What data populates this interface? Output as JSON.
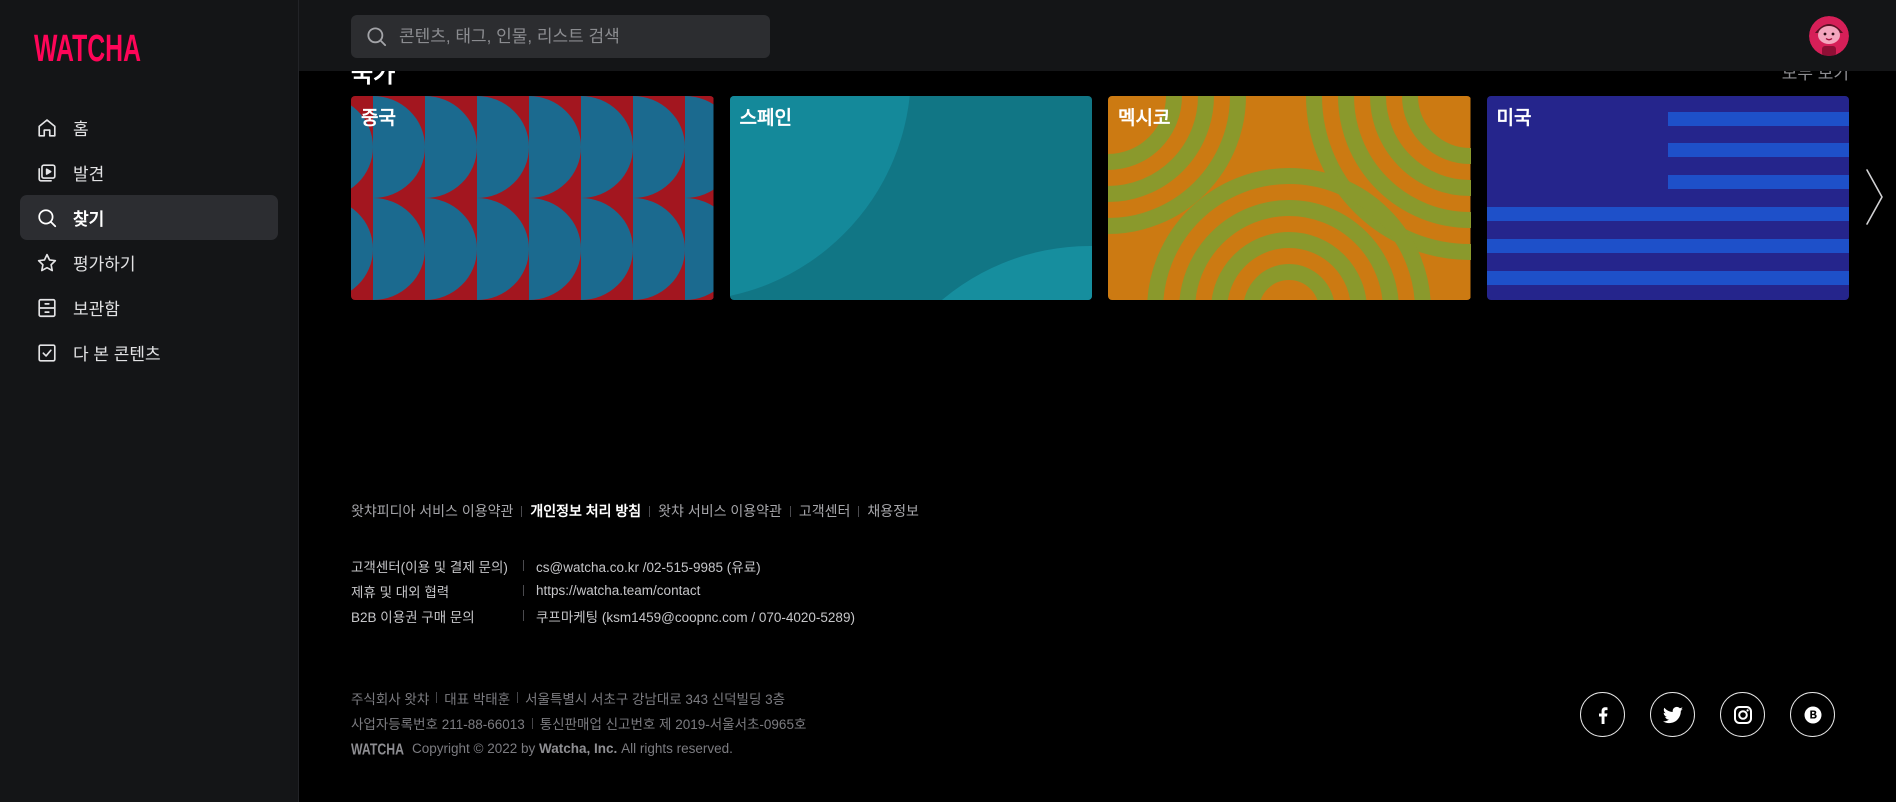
{
  "app": {
    "logo": "WATCHA",
    "colors": {
      "brand": "#ff0558",
      "sidebar_bg": "#141517",
      "main_bg": "#000000",
      "active_item_bg": "#2c2d31",
      "search_bg": "#2c2d30"
    }
  },
  "sidebar": {
    "items": [
      {
        "label": "홈",
        "icon": "home-icon"
      },
      {
        "label": "발견",
        "icon": "discover-icon"
      },
      {
        "label": "찾기",
        "icon": "search-icon",
        "active": true
      },
      {
        "label": "평가하기",
        "icon": "star-icon"
      },
      {
        "label": "보관함",
        "icon": "archive-icon"
      },
      {
        "label": "다 본 콘텐츠",
        "icon": "check-square-icon"
      }
    ]
  },
  "header": {
    "search": {
      "placeholder": "콘텐츠, 태그, 인물, 리스트 검색",
      "value": "",
      "icon": "search-icon"
    },
    "avatar_icon": "avatar-icon"
  },
  "section": {
    "title": "국가",
    "see_all": "모두 보기",
    "next_icon": "chevron-right-icon",
    "cards": [
      {
        "label": "중국",
        "colors": [
          "#1b6a8f",
          "#a3161f"
        ]
      },
      {
        "label": "스페인",
        "colors": [
          "#117685",
          "#14899a"
        ]
      },
      {
        "label": "멕시코",
        "colors": [
          "#cc7a12",
          "#8a992c"
        ]
      },
      {
        "label": "미국",
        "colors": [
          "#25258c",
          "#1e50c9"
        ]
      }
    ]
  },
  "footer": {
    "links": [
      "왓챠피디아 서비스 이용약관",
      "개인정보 처리 방침",
      "왓챠 서비스 이용약관",
      "고객센터",
      "채용정보"
    ],
    "contacts": [
      {
        "label": "고객센터(이용 및 결제 문의)",
        "value": "cs@watcha.co.kr /02-515-9985 (유료)"
      },
      {
        "label": "제휴 및 대외 협력",
        "value": "https://watcha.team/contact"
      },
      {
        "label": "B2B 이용권 구매 문의",
        "value": "쿠프마케팅 (ksm1459@coopnc.com / 070-4020-5289)"
      }
    ],
    "company": {
      "line1": [
        "주식회사 왓챠",
        "대표 박태훈",
        "서울특별시 서초구 강남대로 343 신덕빌딩 3층"
      ],
      "line2": [
        "사업자등록번호 211-88-66013",
        "통신판매업 신고번호 제 2019-서울서초-0965호"
      ],
      "logo": "WATCHA",
      "copyright_prefix": "Copyright © 2022 by",
      "copyright_company": "Watcha, Inc.",
      "copyright_suffix": "All rights reserved."
    },
    "social": [
      "facebook-icon",
      "twitter-icon",
      "instagram-icon",
      "blog-icon"
    ]
  }
}
